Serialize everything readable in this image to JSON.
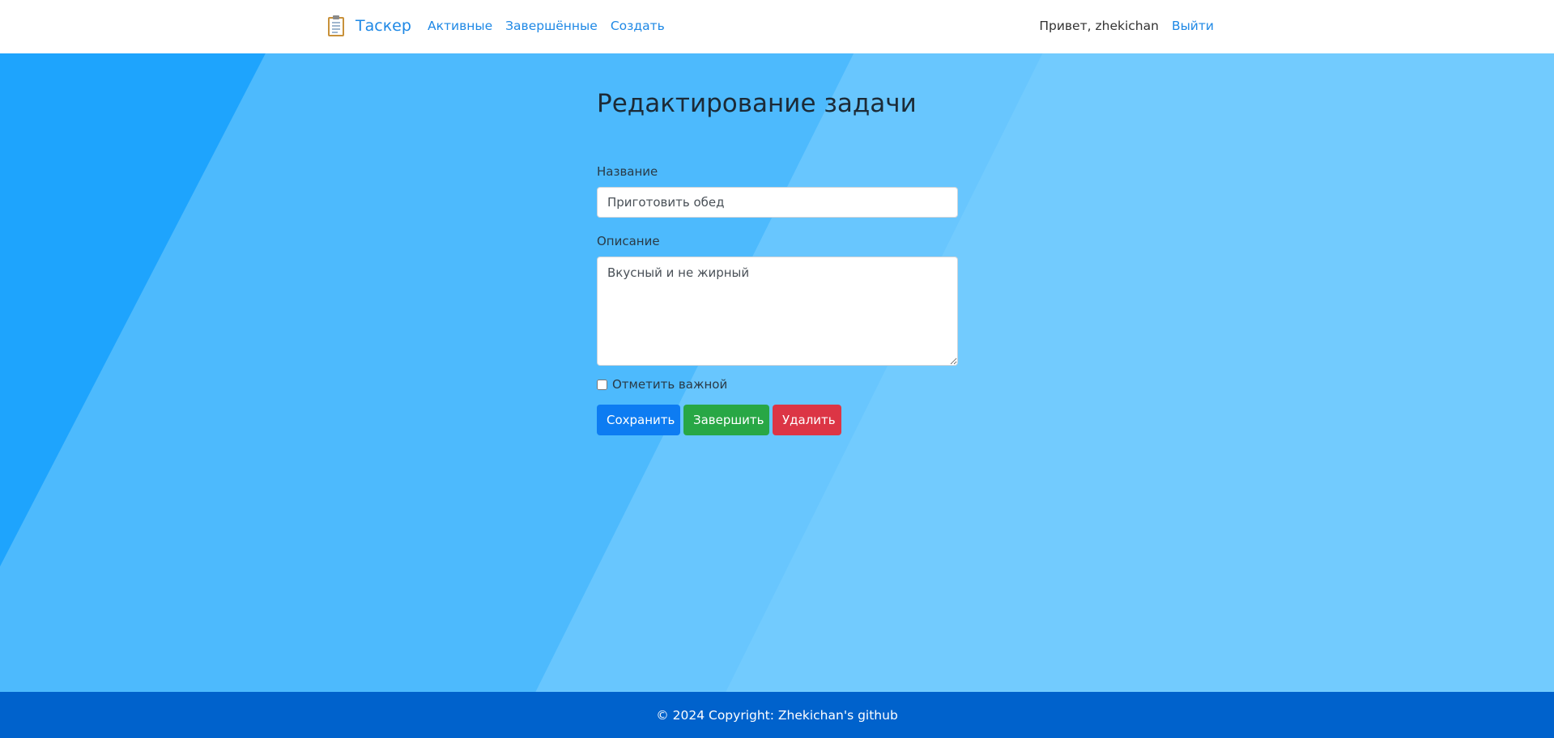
{
  "header": {
    "brand": "Таскер",
    "nav": [
      {
        "label": "Активные"
      },
      {
        "label": "Завершённые"
      },
      {
        "label": "Создать"
      }
    ],
    "greeting": "Привет, zhekichan",
    "logout": "Выйти"
  },
  "form": {
    "title": "Редактирование задачи",
    "name_label": "Название",
    "name_value": "Приготовить обед",
    "description_label": "Описание",
    "description_value": "Вкусный и не жирный",
    "important_label": "Отметить важной",
    "important_checked": false,
    "save_label": "Сохранить",
    "complete_label": "Завершить",
    "delete_label": "Удалить"
  },
  "footer": {
    "text": "© 2024 Copyright: Zhekichan's github"
  },
  "colors": {
    "background_light": "#72cbfe",
    "background_mid": "#4dbafd",
    "background_dark": "#1ea4fd",
    "primary": "#0d7cf2",
    "success": "#28a745",
    "danger": "#dc3545",
    "footer": "#0062cc"
  },
  "icons": {
    "brand": "clipboard-icon"
  }
}
